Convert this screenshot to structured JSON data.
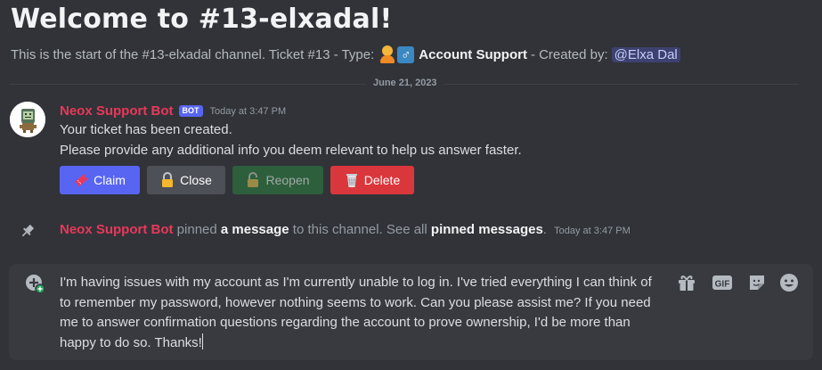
{
  "welcome": {
    "title": "Welcome to #13-elxadal!",
    "desc_prefix": "This is the start of the #13-elxadal channel. Ticket #13 - Type:",
    "type_label": "Account Support",
    "created_by_label": "- Created by:",
    "creator_mention": "@Elxa Dal"
  },
  "divider": {
    "date": "June 21, 2023"
  },
  "message": {
    "author": "Neox Support Bot",
    "bot_tag": "BOT",
    "timestamp": "Today at 3:47 PM",
    "line1": "Your ticket has been created.",
    "line2": "Please provide any additional info you deem relevant to help us answer faster.",
    "buttons": {
      "claim": "Claim",
      "close": "Close",
      "reopen": "Reopen",
      "delete": "Delete"
    },
    "button_colors": {
      "claim": "#5865f2",
      "close": "#4e5058",
      "reopen": "#2d5f3d",
      "delete": "#da373c"
    }
  },
  "pin_notice": {
    "author": "Neox Support Bot",
    "text1": "pinned",
    "link1": "a message",
    "text2": "to this channel. See all",
    "link2": "pinned messages",
    "text3": ".",
    "timestamp": "Today at 3:47 PM"
  },
  "composer": {
    "text": "I'm having issues with my account as I'm currently unable to log in. I've tried everything I can think of to remember my password, however nothing seems to work. Can you please assist me? If you need me to answer confirmation questions regarding the account to prove ownership, I'd be more than happy to do so. Thanks!",
    "icons": [
      "gift-icon",
      "gif-icon",
      "sticker-icon",
      "emoji-icon"
    ],
    "gif_label": "GIF"
  },
  "colors": {
    "background": "#313338",
    "author": "#e8385a",
    "composer_bg": "#383a40"
  }
}
